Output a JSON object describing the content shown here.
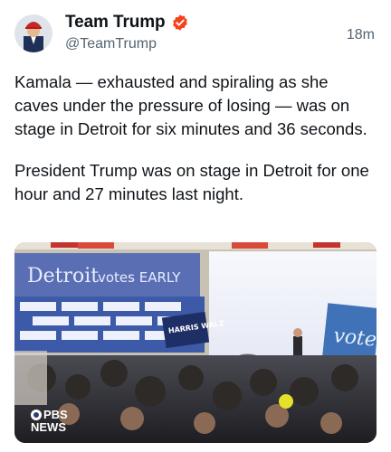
{
  "author": {
    "display_name": "Team Trump",
    "handle": "@TeamTrump",
    "verified": true,
    "avatar_icon": "profile-photo"
  },
  "post": {
    "timestamp": "18m",
    "paragraph_1": "Kamala — exhausted and spiraling as she caves under the pressure of losing — was on stage in Detroit for six minutes and 36 seconds.",
    "paragraph_2": "President Trump was on stage in Detroit for one hour and 27 minutes last night."
  },
  "media": {
    "banner_text_1": "Detroit",
    "banner_text_2": "votes EARLY",
    "sign_right": "vote",
    "sign_harris": "HARRIS WALZ",
    "watermark_line1": "PBS",
    "watermark_line2": "NEWS"
  },
  "colors": {
    "verified_badge": "#f6421a",
    "text_primary": "#0f1419",
    "text_secondary": "#536471"
  }
}
